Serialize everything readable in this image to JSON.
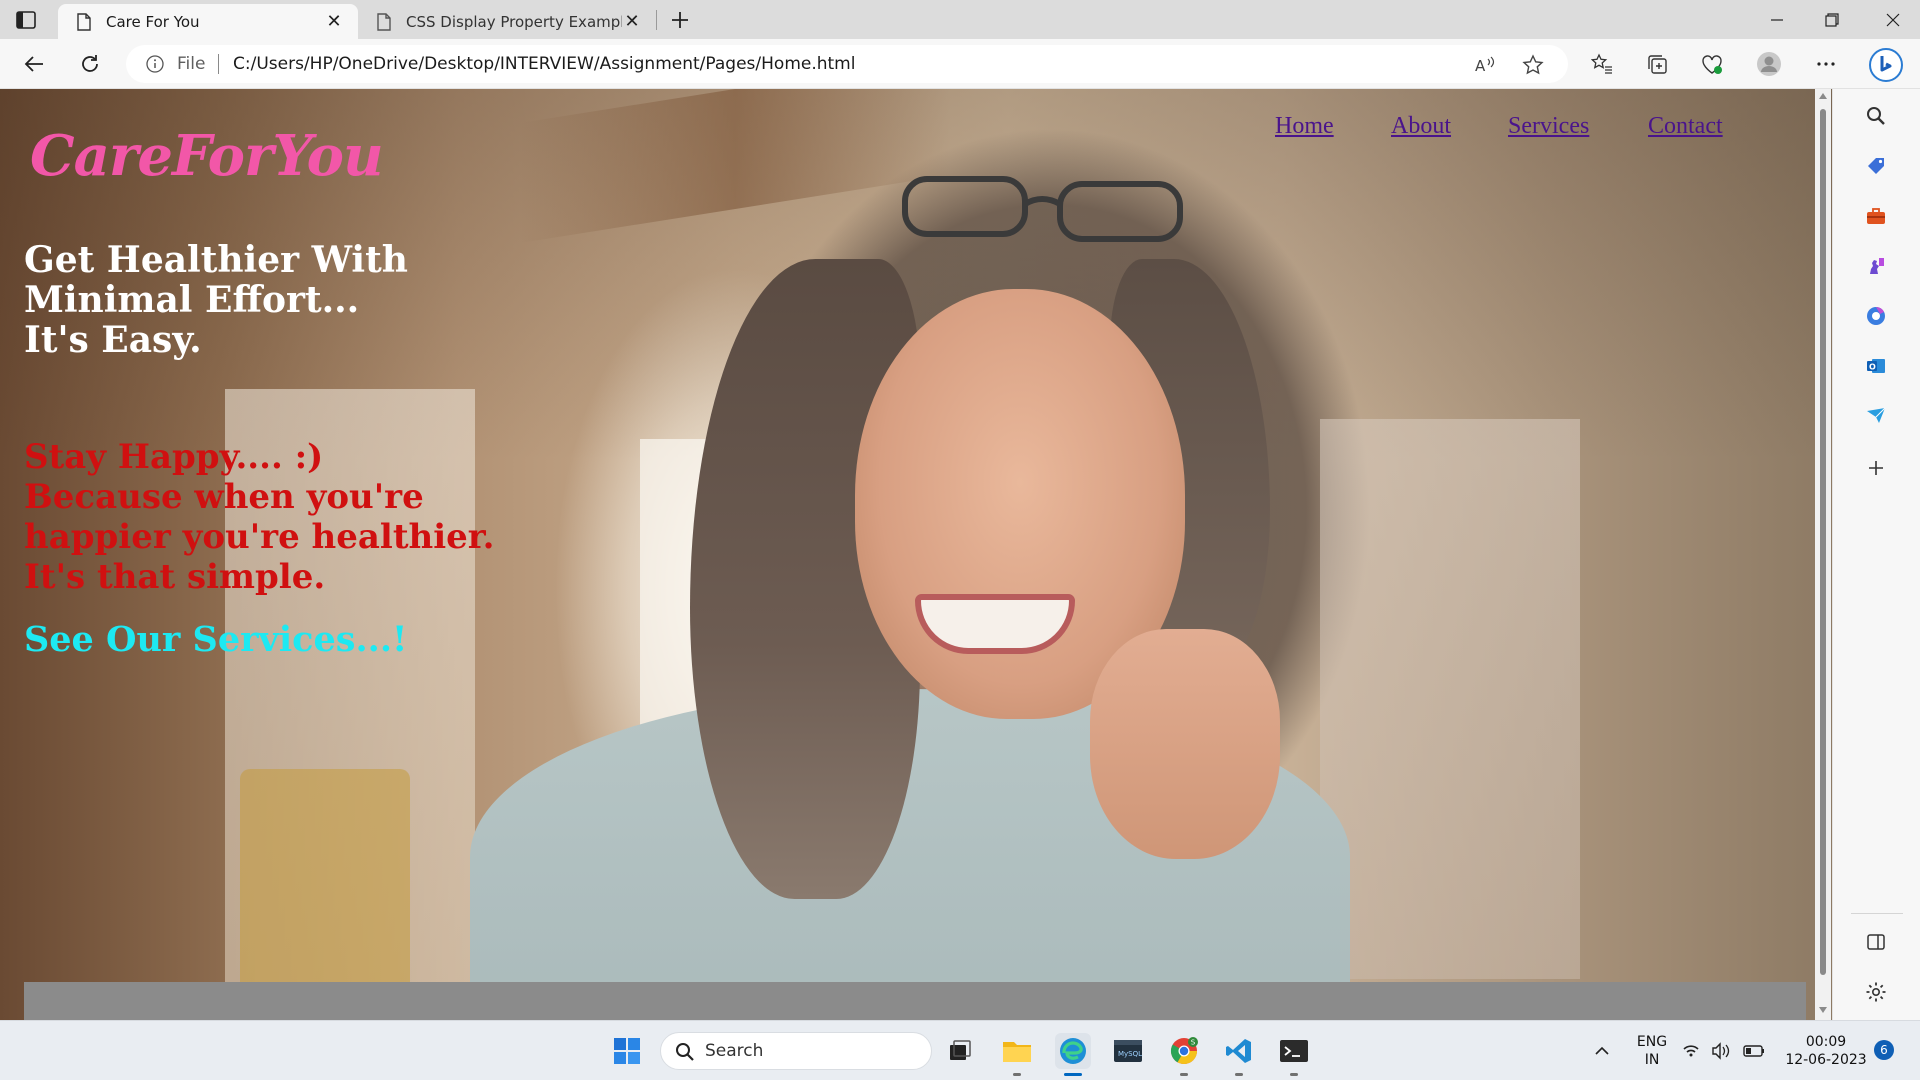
{
  "browser": {
    "tabs": [
      {
        "title": "Care For You",
        "active": true
      },
      {
        "title": "CSS Display Property Example",
        "active": false
      }
    ],
    "address": {
      "scheme_label": "File",
      "url": "C:/Users/HP/OneDrive/Desktop/INTERVIEW/Assignment/Pages/Home.html"
    }
  },
  "page": {
    "logo": "CareForYou",
    "nav": [
      "Home",
      "About",
      "Services",
      "Contact"
    ],
    "headline_lines": [
      "Get Healthier With",
      "Minimal Effort...",
      "It's Easy."
    ],
    "tagline_lines": [
      "Stay Happy.... :)",
      "Because when you're",
      "happier you're healthier.",
      "It's that simple."
    ],
    "cta": "See Our Services...!",
    "colors": {
      "logo": "#f257a8",
      "nav_link": "#4a148c",
      "headline": "#ffffff",
      "tagline": "#d01010",
      "cta": "#1de9f2",
      "footer_bar": "#8b8b8b"
    }
  },
  "taskbar": {
    "search_label": "Search",
    "lang_top": "ENG",
    "lang_bottom": "IN",
    "time": "00:09",
    "date": "12-06-2023",
    "notification_count": "6"
  }
}
